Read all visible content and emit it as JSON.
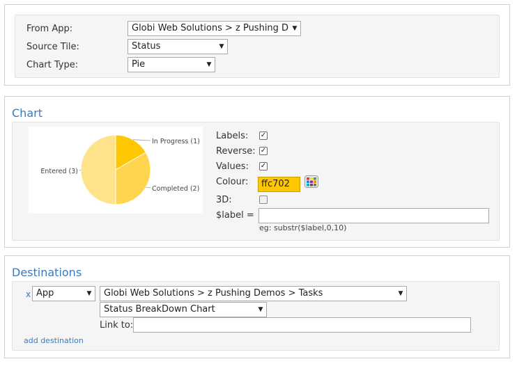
{
  "source": {
    "from_app_label": "From App:",
    "from_app_value": "Globi Web Solutions > z Pushing Demos",
    "source_tile_label": "Source Tile:",
    "source_tile_value": "Status",
    "chart_type_label": "Chart Type:",
    "chart_type_value": "Pie"
  },
  "chart_section": {
    "heading": "Chart",
    "options": {
      "labels_label": "Labels:",
      "labels_checked": true,
      "reverse_label": "Reverse:",
      "reverse_checked": true,
      "values_label": "Values:",
      "values_checked": true,
      "colour_label": "Colour:",
      "colour_value": "ffc702",
      "threed_label": "3D:",
      "threed_checked": false,
      "label_expr_label": "$label =",
      "label_expr_value": "",
      "label_expr_hint": "eg: substr($label,0,10)"
    },
    "preview_colors": [
      "#ffc702",
      "#ffd54f",
      "#ffe38a"
    ]
  },
  "chart_data": {
    "type": "pie",
    "categories": [
      "In Progress (1)",
      "Completed (2)",
      "Entered (3)"
    ],
    "values": [
      1,
      2,
      3
    ],
    "title": "",
    "xlabel": "",
    "ylabel": ""
  },
  "destinations": {
    "heading": "Destinations",
    "remove_label": "x",
    "type_value": "App",
    "app_value": "Globi Web Solutions > z Pushing Demos > Tasks",
    "tile_value": "Status BreakDown Chart",
    "link_to_label": "Link to:",
    "link_to_value": "",
    "add_label": "add destination"
  },
  "icons": {
    "dropdown": "▼",
    "check": "✓"
  }
}
